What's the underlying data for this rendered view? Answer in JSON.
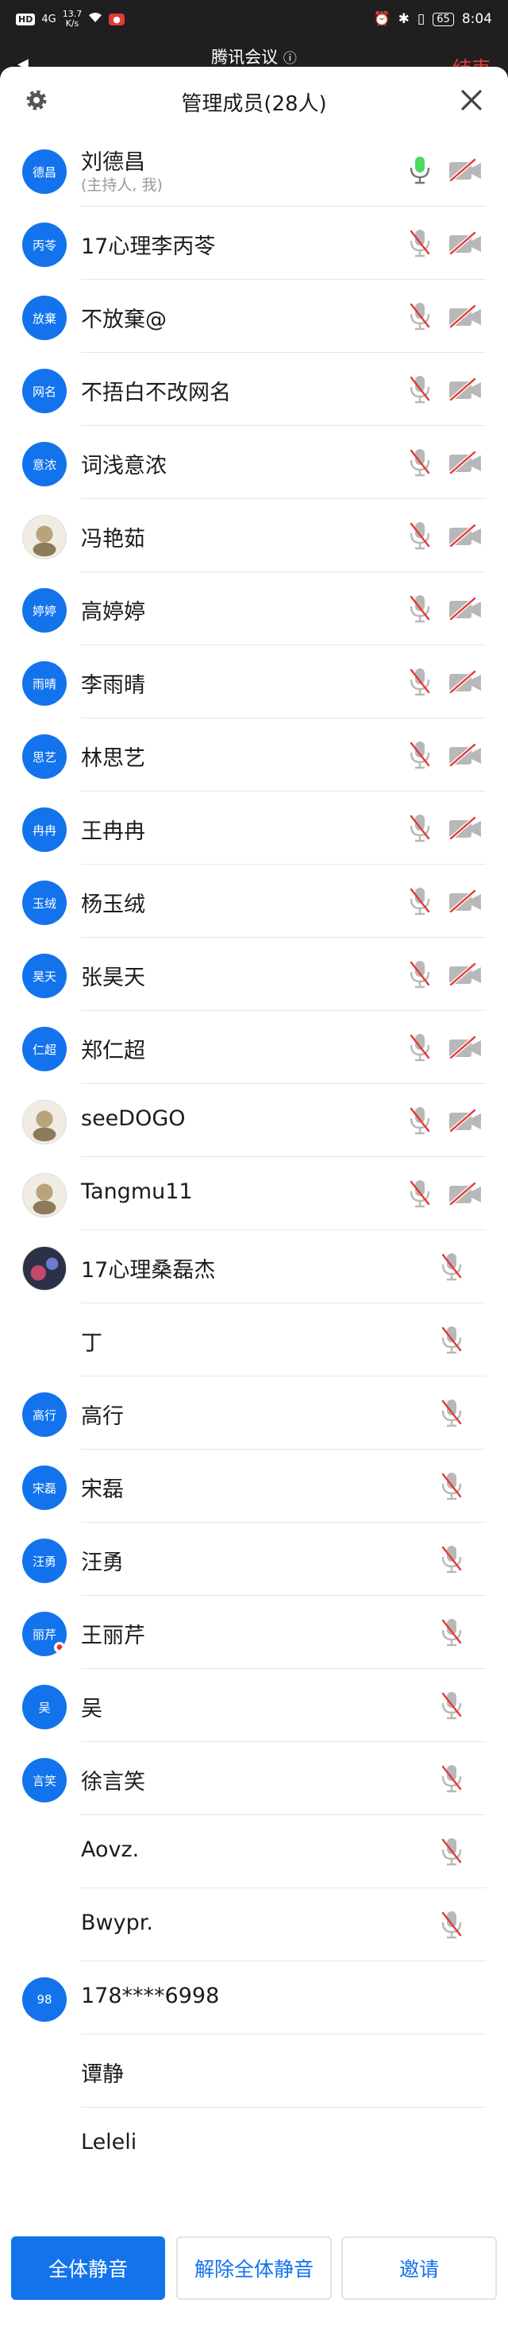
{
  "status_bar": {
    "left_badge": "HD",
    "signal": "4G",
    "speed_value": "13.7",
    "speed_unit": "K/s",
    "time": "8:04",
    "battery": "65"
  },
  "meeting": {
    "title": "腾讯会议",
    "end_label": "结束"
  },
  "panel": {
    "title": "管理成员(28人)"
  },
  "members": [
    {
      "avatar_text": "德昌",
      "name": "刘德昌",
      "subtitle": "(主持人, 我)",
      "mic": "on",
      "cam": "off"
    },
    {
      "avatar_text": "丙苓",
      "name": "17心理李丙苓",
      "mic": "off",
      "cam": "off"
    },
    {
      "avatar_text": "放棄",
      "name": "不放棄@",
      "mic": "off",
      "cam": "off"
    },
    {
      "avatar_text": "网名",
      "name": "不捂白不改网名",
      "mic": "off",
      "cam": "off"
    },
    {
      "avatar_text": "意浓",
      "name": "词浅意浓",
      "mic": "off",
      "cam": "off"
    },
    {
      "avatar_text": "",
      "avatar_kind": "photo",
      "name": "冯艳茹",
      "mic": "off",
      "cam": "off"
    },
    {
      "avatar_text": "婷婷",
      "name": "高婷婷",
      "mic": "off",
      "cam": "off"
    },
    {
      "avatar_text": "雨晴",
      "name": "李雨晴",
      "mic": "off",
      "cam": "off"
    },
    {
      "avatar_text": "思艺",
      "name": "林思艺",
      "mic": "off",
      "cam": "off"
    },
    {
      "avatar_text": "冉冉",
      "name": "王冉冉",
      "mic": "off",
      "cam": "off"
    },
    {
      "avatar_text": "玉绒",
      "name": "杨玉绒",
      "mic": "off",
      "cam": "off"
    },
    {
      "avatar_text": "昊天",
      "name": "张昊天",
      "mic": "off",
      "cam": "off"
    },
    {
      "avatar_text": "仁超",
      "name": "郑仁超",
      "mic": "off",
      "cam": "off"
    },
    {
      "avatar_text": "",
      "avatar_kind": "photo",
      "name": "seeDOGO",
      "mic": "off",
      "cam": "off"
    },
    {
      "avatar_text": "",
      "avatar_kind": "photo",
      "name": "Tangmu11",
      "mic": "off",
      "cam": "off"
    },
    {
      "avatar_text": "",
      "avatar_kind": "photo-dark",
      "name": "17心理桑磊杰",
      "mic": "off",
      "cam": "none"
    },
    {
      "avatar_text": "",
      "avatar_kind": "empty",
      "name": "丁",
      "mic": "off",
      "cam": "none"
    },
    {
      "avatar_text": "高行",
      "name": "高行",
      "mic": "off",
      "cam": "none"
    },
    {
      "avatar_text": "宋磊",
      "name": "宋磊",
      "mic": "off",
      "cam": "none"
    },
    {
      "avatar_text": "汪勇",
      "name": "汪勇",
      "mic": "off",
      "cam": "none"
    },
    {
      "avatar_text": "丽芹",
      "name": "王丽芹",
      "mic": "off",
      "cam": "none",
      "avatar_badge": true
    },
    {
      "avatar_text": "吴",
      "name": "吴",
      "mic": "off",
      "cam": "none"
    },
    {
      "avatar_text": "言笑",
      "name": "徐言笑",
      "mic": "off",
      "cam": "none"
    },
    {
      "avatar_text": "",
      "avatar_kind": "empty",
      "name": "Aovz.",
      "mic": "off",
      "cam": "none"
    },
    {
      "avatar_text": "",
      "avatar_kind": "empty",
      "name": "Bwypr.",
      "mic": "off",
      "cam": "none"
    },
    {
      "avatar_text": "98",
      "name": "178****6998",
      "mic": "none",
      "cam": "none"
    },
    {
      "avatar_text": "",
      "avatar_kind": "empty",
      "name": "谭静",
      "mic": "none",
      "cam": "none"
    },
    {
      "avatar_text": "",
      "avatar_kind": "empty",
      "name": "Leleli",
      "mic": "none",
      "cam": "none"
    }
  ],
  "footer": {
    "mute_all": "全体静音",
    "unmute_all": "解除全体静音",
    "invite": "邀请"
  },
  "colors": {
    "accent": "#1273ec",
    "mic_on": "#4cd964",
    "muted_slash": "#e53935",
    "icon_gray": "#b8b8b8",
    "end_red": "#e53935"
  }
}
